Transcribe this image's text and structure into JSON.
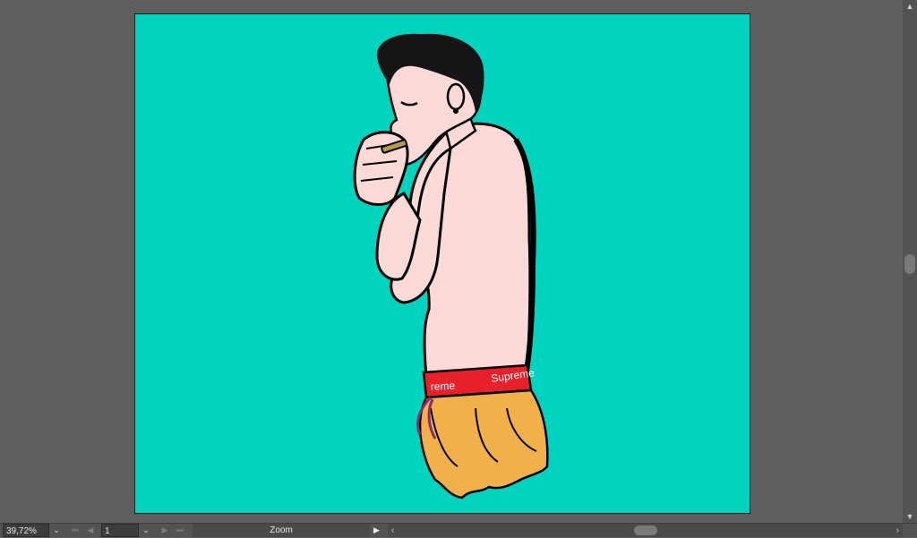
{
  "statusbar": {
    "zoom_value": "39,72%",
    "zoom_dropdown_icon": "chevron-down-icon",
    "artboard_number": "1",
    "artboard_dropdown_icon": "chevron-down-icon",
    "status_text": "Zoom",
    "play_icon": "triangle-right-icon"
  },
  "nav_icons": {
    "first": "first-artboard-icon",
    "previous": "previous-artboard-icon",
    "next": "next-artboard-icon",
    "last": "last-artboard-icon"
  },
  "artboard": {
    "background_color": "#00d4bf",
    "waistband_text": "Supreme",
    "waistband_text_back": "reme",
    "waistband_color": "#e8202a",
    "shorts_color": "#f1b04a",
    "skin_color": "#fbd9d6",
    "drawstring_color": "#8a2d6e"
  }
}
